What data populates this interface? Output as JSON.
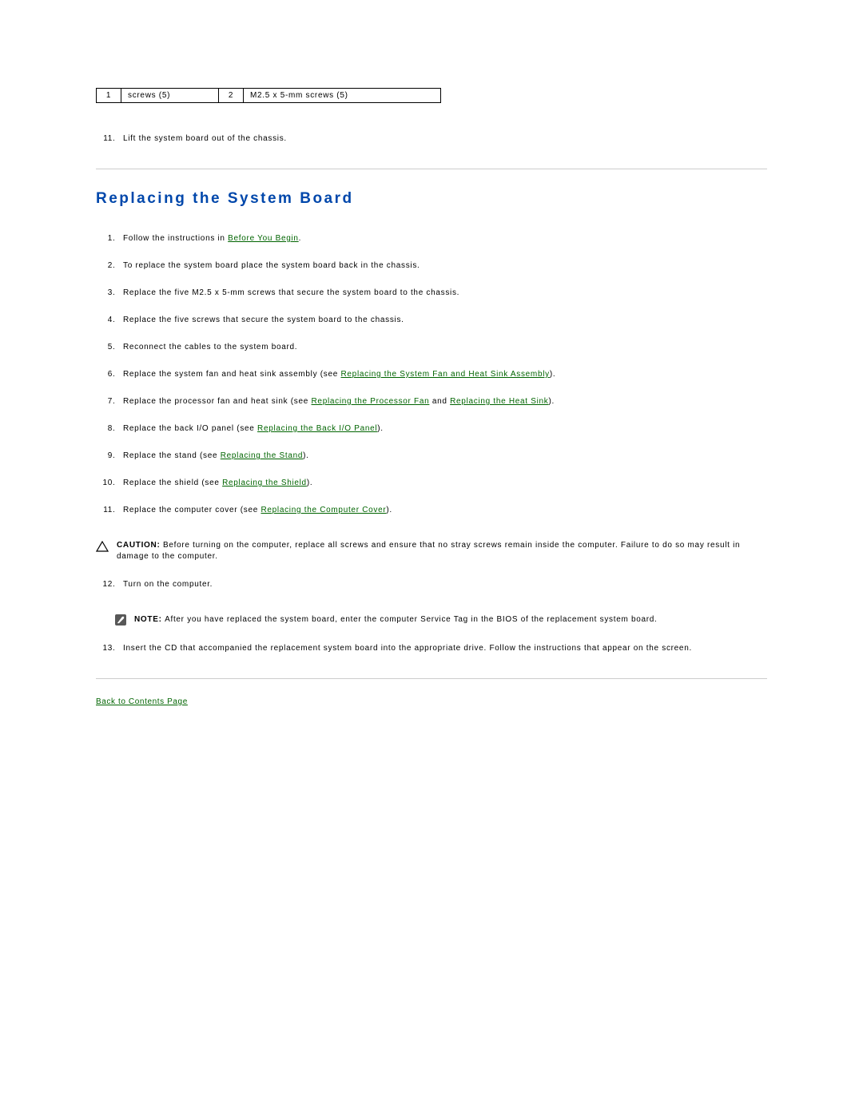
{
  "callout": {
    "c1_num": "1",
    "c1_label": "screws (5)",
    "c2_num": "2",
    "c2_label": "M2.5 x 5-mm screws (5)"
  },
  "pre_step_11": "Lift the system board out of the chassis.",
  "section_heading": "Replacing the System Board",
  "steps": {
    "s1_a": "Follow the instructions in ",
    "s1_link": "Before You Begin",
    "s1_b": ".",
    "s2": "To replace the system board place the system board back in the chassis.",
    "s3": "Replace the five M2.5 x 5-mm screws that secure the system board to the chassis.",
    "s4": "Replace the five screws that secure the system board to the chassis.",
    "s5": "Reconnect the cables to the system board.",
    "s6_a": "Replace the system fan and heat sink assembly (see ",
    "s6_link": "Replacing the System Fan and Heat Sink Assembly",
    "s6_b": ").",
    "s7_a": "Replace the processor fan and heat sink (see ",
    "s7_link1": "Replacing the Processor Fan",
    "s7_mid": " and ",
    "s7_link2": "Replacing the Heat Sink",
    "s7_b": ").",
    "s8_a": "Replace the back I/O panel (see ",
    "s8_link": "Replacing the Back I/O Panel",
    "s8_b": ").",
    "s9_a": "Replace the stand (see ",
    "s9_link": "Replacing the Stand",
    "s9_b": ").",
    "s10_a": "Replace the shield (see ",
    "s10_link": "Replacing the Shield",
    "s10_b": ").",
    "s11_a": "Replace the computer cover (see ",
    "s11_link": "Replacing the Computer Cover",
    "s11_b": ").",
    "s12": "Turn on the computer.",
    "s13": "Insert the CD that accompanied the replacement system board into the appropriate drive. Follow the instructions that appear on the screen."
  },
  "caution": {
    "label": "CAUTION: ",
    "text": "Before turning on the computer, replace all screws and ensure that no stray screws remain inside the computer. Failure to do so may result in damage to the computer."
  },
  "note": {
    "label": "NOTE: ",
    "text": "After you have replaced the system board, enter the computer Service Tag in the BIOS of the replacement system board."
  },
  "back_link": "Back to Contents Page"
}
